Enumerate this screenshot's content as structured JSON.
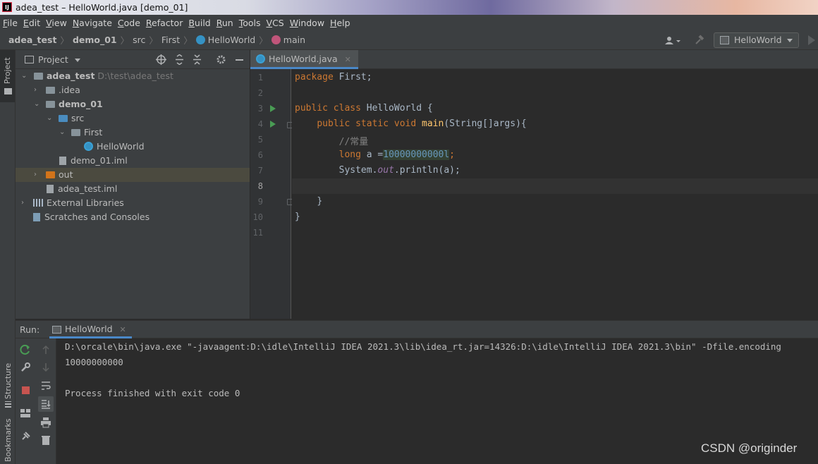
{
  "window": {
    "title": "adea_test – HelloWorld.java [demo_01]",
    "logo": "IJ"
  },
  "menu": [
    "File",
    "Edit",
    "View",
    "Navigate",
    "Code",
    "Refactor",
    "Build",
    "Run",
    "Tools",
    "VCS",
    "Window",
    "Help"
  ],
  "breadcrumb": {
    "items": [
      "adea_test",
      "demo_01",
      "src",
      "First",
      "HelloWorld",
      "main"
    ]
  },
  "toolbar": {
    "run_config": "HelloWorld"
  },
  "left_strip": {
    "project_label": "Project",
    "structure_label": "Structure",
    "bookmarks_label": "Bookmarks"
  },
  "project": {
    "header": "Project",
    "tree": [
      {
        "label": "adea_test",
        "path": "D:\\test\\adea_test"
      },
      {
        "label": ".idea"
      },
      {
        "label": "demo_01"
      },
      {
        "label": "src"
      },
      {
        "label": "First"
      },
      {
        "label": "HelloWorld"
      },
      {
        "label": "demo_01.iml"
      },
      {
        "label": "out"
      },
      {
        "label": "adea_test.iml"
      },
      {
        "label": "External Libraries"
      },
      {
        "label": "Scratches and Consoles"
      }
    ]
  },
  "editor": {
    "tab": "HelloWorld.java",
    "line_numbers": [
      "1",
      "2",
      "3",
      "4",
      "5",
      "6",
      "7",
      "8",
      "9",
      "10",
      "11"
    ],
    "code": {
      "l1_kw": "package",
      "l1_rest": " First;",
      "l3_kw": "public class",
      "l3_rest": " HelloWorld {",
      "l4_kw": "public static void",
      "l4_fn": "main",
      "l4_rest": "(String[]args){",
      "l5_cmt": "//常量",
      "l6_kw": "long",
      "l6_mid": " a =",
      "l6_num": "10000000000l",
      "l6_end": ";",
      "l7_a": "System.",
      "l7_fld": "out",
      "l7_b": ".println(a);",
      "l9": "}",
      "l10": "}"
    }
  },
  "run": {
    "label": "Run:",
    "tab": "HelloWorld",
    "console": [
      "D:\\orcale\\bin\\java.exe \"-javaagent:D:\\idle\\IntelliJ IDEA 2021.3\\lib\\idea_rt.jar=14326:D:\\idle\\IntelliJ IDEA 2021.3\\bin\" -Dfile.encoding",
      "10000000000",
      "",
      "Process finished with exit code 0"
    ]
  },
  "watermark": "CSDN @originder",
  "colors": {
    "accent": "#4a88c7",
    "keyword": "#cc7832",
    "function": "#ffc66d",
    "number": "#6897bb",
    "run_green": "#499c54"
  }
}
